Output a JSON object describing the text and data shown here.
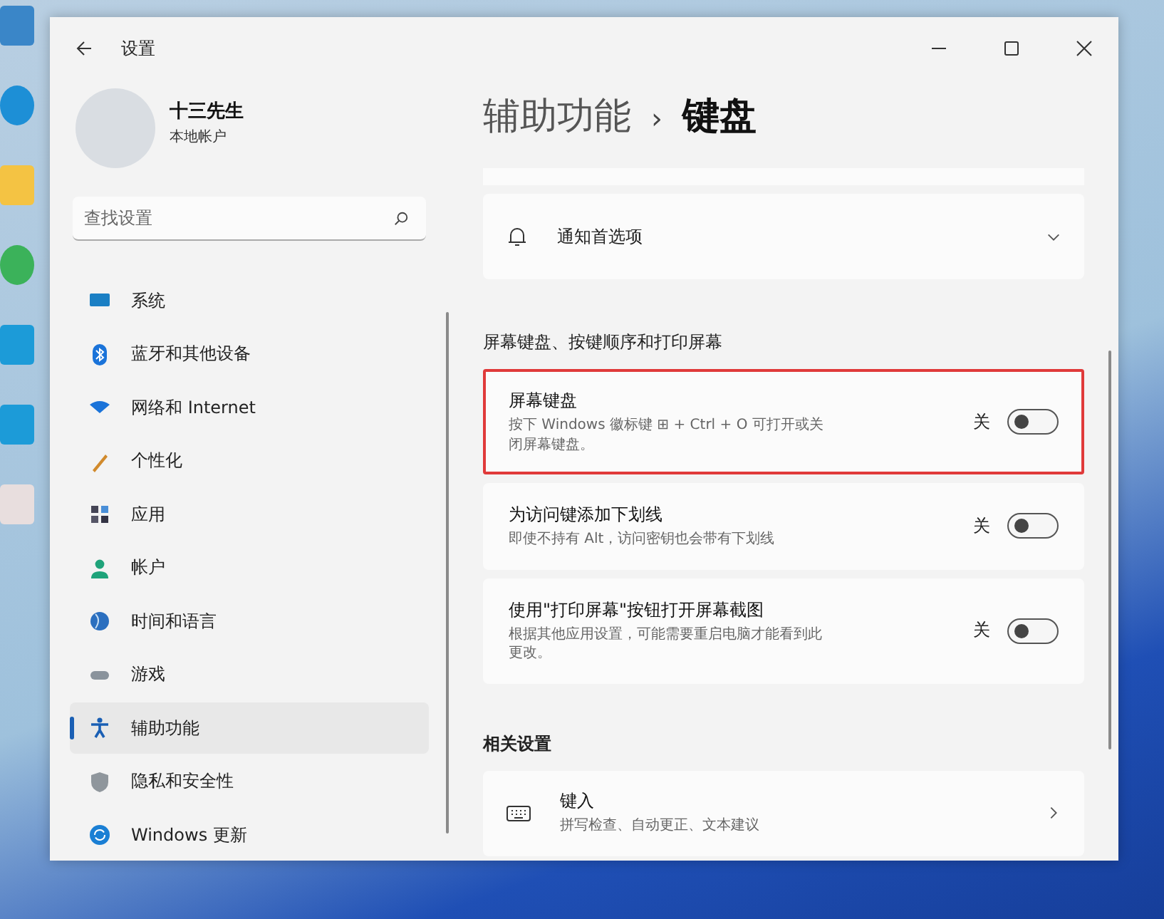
{
  "window": {
    "title": "设置"
  },
  "account": {
    "name": "十三先生",
    "type": "本地帐户"
  },
  "search": {
    "placeholder": "查找设置"
  },
  "sidebar": {
    "items": [
      {
        "label": "系统",
        "selected": false
      },
      {
        "label": "蓝牙和其他设备",
        "selected": false
      },
      {
        "label": "网络和 Internet",
        "selected": false
      },
      {
        "label": "个性化",
        "selected": false
      },
      {
        "label": "应用",
        "selected": false
      },
      {
        "label": "帐户",
        "selected": false
      },
      {
        "label": "时间和语言",
        "selected": false
      },
      {
        "label": "游戏",
        "selected": false
      },
      {
        "label": "辅助功能",
        "selected": true
      },
      {
        "label": "隐私和安全性",
        "selected": false
      },
      {
        "label": "Windows 更新",
        "selected": false
      }
    ]
  },
  "breadcrumb": {
    "parent": "辅助功能",
    "separator": "›",
    "current": "键盘"
  },
  "notification_card": {
    "label": "通知首选项",
    "expanded": false
  },
  "section_title": "屏幕键盘、按键顺序和打印屏幕",
  "settings": [
    {
      "title": "屏幕键盘",
      "description": "按下 Windows 徽标键 ⊞ + Ctrl + O 可打开或关闭屏幕键盘。",
      "state_label": "关",
      "on": false,
      "highlighted": true
    },
    {
      "title": "为访问键添加下划线",
      "description": "即使不持有 Alt，访问密钥也会带有下划线",
      "state_label": "关",
      "on": false,
      "highlighted": false
    },
    {
      "title": "使用\"打印屏幕\"按钮打开屏幕截图",
      "description": "根据其他应用设置，可能需要重启电脑才能看到此更改。",
      "state_label": "关",
      "on": false,
      "highlighted": false
    }
  ],
  "related": {
    "title": "相关设置",
    "items": [
      {
        "title": "键入",
        "description": "拼写检查、自动更正、文本建议"
      }
    ]
  }
}
